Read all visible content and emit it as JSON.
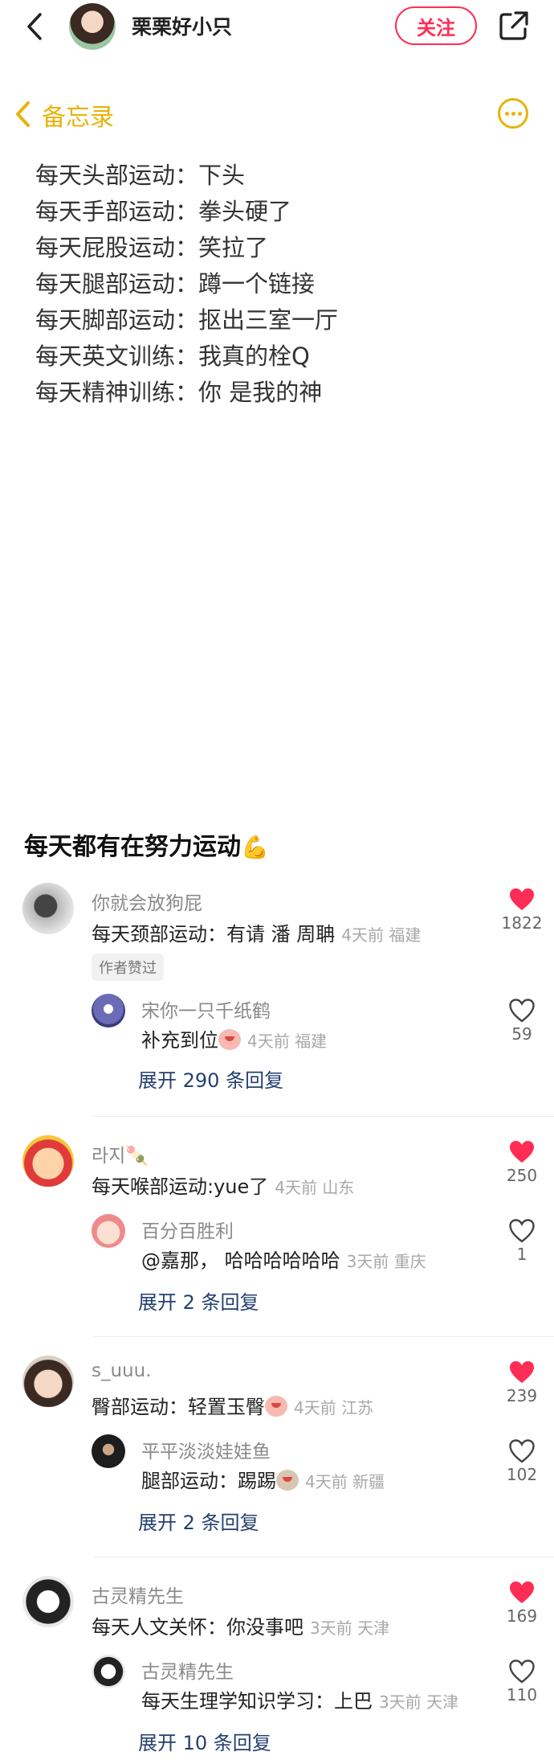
{
  "header": {
    "username": "栗栗好小只",
    "follow_label": "关注"
  },
  "memo": {
    "title": "备忘录",
    "lines": [
      "每天头部运动：下头",
      "每天手部运动：拳头硬了",
      "每天屁股运动：笑拉了",
      "每天腿部运动：蹲一个链接",
      "每天脚部运动：抠出三室一厅",
      "每天英文训练：我真的栓Q",
      "每天精神训练：你 是我的神"
    ]
  },
  "post": {
    "title": "每天都有在努力运动"
  },
  "comments": [
    {
      "name": "你就会放狗屁",
      "text": "每天颈部运动：有请 潘 周聃",
      "meta": "4天前 福建",
      "likes": "1822",
      "liked": true,
      "author_tag": "作者赞过",
      "reply": {
        "name": "宋你一只千纸鹤",
        "text": "补充到位",
        "meta": "4天前 福建",
        "likes": "59",
        "liked": false
      },
      "expand": "展开 290 条回复"
    },
    {
      "name": "라지🍡",
      "text": "每天喉部运动:yue了",
      "meta": "4天前 山东",
      "likes": "250",
      "liked": true,
      "reply": {
        "name": "百分百胜利",
        "text": "@嘉那，  哈哈哈哈哈哈",
        "meta": "3天前 重庆",
        "likes": "1",
        "liked": false
      },
      "expand": "展开 2 条回复"
    },
    {
      "name": "s_uuu.",
      "text": "臀部运动：轻置玉臀",
      "meta": "4天前 江苏",
      "likes": "239",
      "liked": true,
      "reply": {
        "name": "平平淡淡娃娃鱼",
        "text": "腿部运动：踢踢",
        "meta": "4天前 新疆",
        "likes": "102",
        "liked": false
      },
      "expand": "展开 2 条回复"
    },
    {
      "name": "古灵精先生",
      "text": "每天人文关怀：你没事吧",
      "meta": "3天前 天津",
      "likes": "169",
      "liked": true,
      "reply": {
        "name": "古灵精先生",
        "text": "每天生理学知识学习：上巴",
        "meta": "3天前 天津",
        "likes": "110",
        "liked": false
      },
      "expand": "展开 10 条回复"
    }
  ],
  "colors": {
    "accent_red": "#ff2d55",
    "memo_yellow": "#e8b30a",
    "link_blue": "#24406e"
  }
}
